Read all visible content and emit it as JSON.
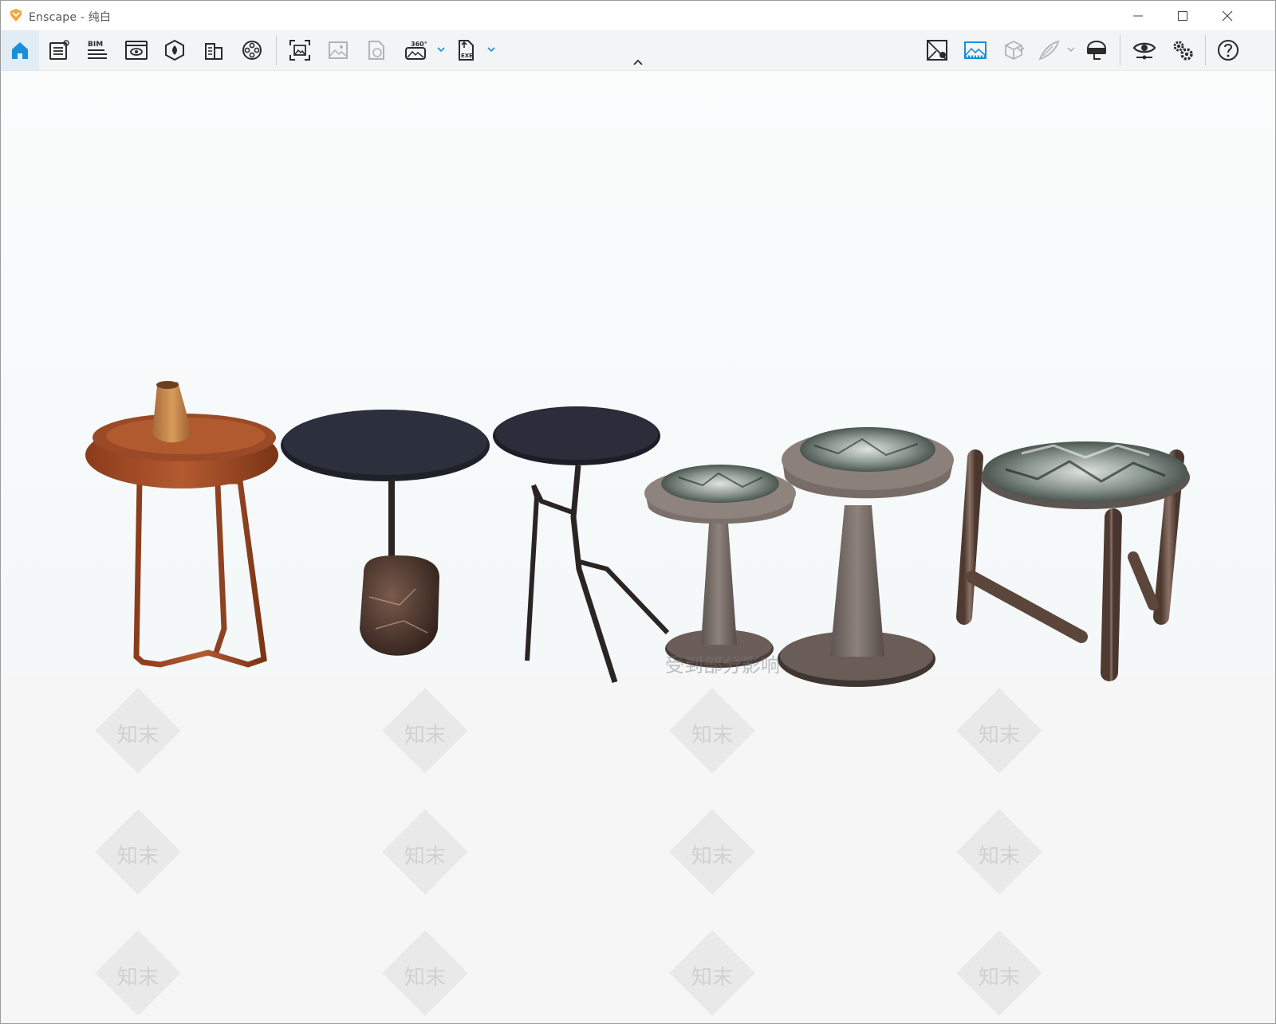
{
  "window": {
    "app_name": "Enscape",
    "title": "Enscape - 纯白",
    "controls": [
      "minimize",
      "maximize",
      "close"
    ]
  },
  "toolbar": {
    "left_items": [
      {
        "icon": "home-icon",
        "active": true
      },
      {
        "icon": "notes-icon"
      },
      {
        "icon": "bim-icon",
        "label": "BIM"
      },
      {
        "icon": "view-window-icon"
      },
      {
        "icon": "asset-library-icon"
      },
      {
        "icon": "buildings-icon"
      },
      {
        "icon": "video-reel-icon"
      },
      {
        "icon": "screenshot-icon"
      },
      {
        "icon": "batch-render-icon",
        "disabled": true
      },
      {
        "icon": "web-standalone-icon",
        "disabled": true
      },
      {
        "icon": "panorama-360-icon",
        "label": "360°"
      },
      {
        "icon": "export-exe-icon",
        "label": "EXE"
      }
    ],
    "right_items": [
      {
        "icon": "map-marker-icon"
      },
      {
        "icon": "atmosphere-image-icon",
        "active": true
      },
      {
        "icon": "cube-icon",
        "disabled": true
      },
      {
        "icon": "feather-icon",
        "disabled": true
      },
      {
        "icon": "vr-headset-icon"
      },
      {
        "icon": "eye-view-icon"
      },
      {
        "icon": "settings-gears-icon"
      },
      {
        "icon": "help-icon"
      }
    ]
  },
  "viewport": {
    "scene": "render of six side tables on white background",
    "watermark_text": "知末",
    "overlay_text": "受到部分影响"
  },
  "colors": {
    "accent": "#1a8fd9",
    "icon": "#2b2b2b",
    "icon_disabled": "#b0b4b7",
    "logo": "#f2a33a"
  }
}
